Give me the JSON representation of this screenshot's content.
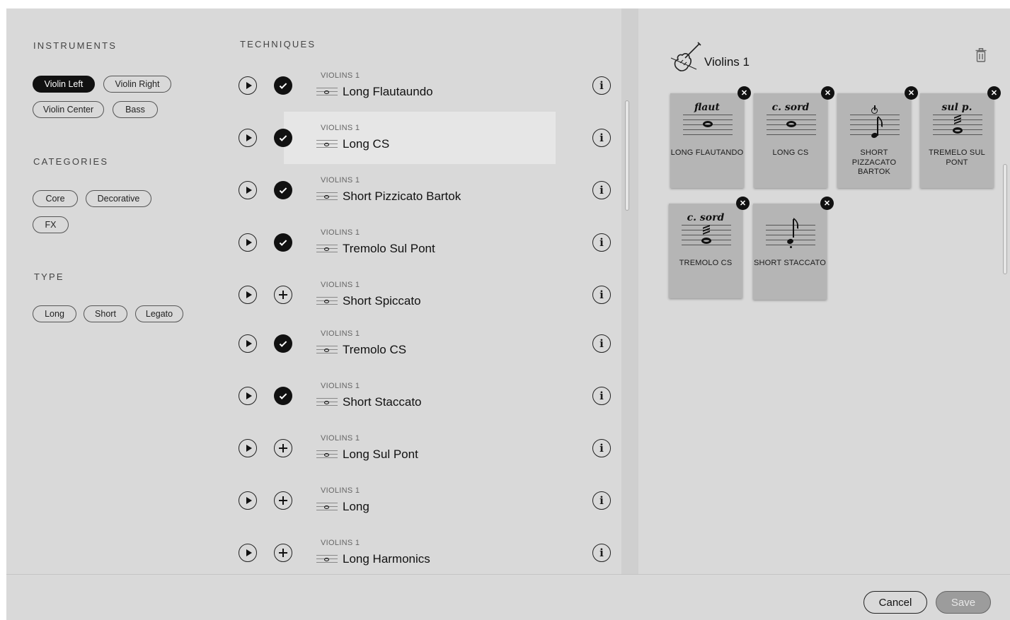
{
  "filters": {
    "instruments": {
      "title": "INSTRUMENTS",
      "items": [
        {
          "label": "Violin Left",
          "active": true
        },
        {
          "label": "Violin Right",
          "active": false
        },
        {
          "label": "Violin Center",
          "active": false
        },
        {
          "label": "Bass",
          "active": false
        }
      ]
    },
    "categories": {
      "title": "CATEGORIES",
      "items": [
        {
          "label": "Core"
        },
        {
          "label": "Decorative"
        },
        {
          "label": "FX"
        }
      ]
    },
    "type": {
      "title": "TYPE",
      "items": [
        {
          "label": "Long"
        },
        {
          "label": "Short"
        },
        {
          "label": "Legato"
        }
      ]
    }
  },
  "techniques": {
    "title": "TECHNIQUES",
    "rows": [
      {
        "instrument": "VIOLINS 1",
        "name": "Long Flautaundo",
        "selected": true,
        "highlighted": false
      },
      {
        "instrument": "VIOLINS 1",
        "name": "Long CS",
        "selected": true,
        "highlighted": true
      },
      {
        "instrument": "VIOLINS 1",
        "name": "Short Pizzicato Bartok",
        "selected": true,
        "highlighted": false
      },
      {
        "instrument": "VIOLINS 1",
        "name": "Tremolo Sul Pont",
        "selected": true,
        "highlighted": false
      },
      {
        "instrument": "VIOLINS 1",
        "name": "Short Spiccato",
        "selected": false,
        "highlighted": false
      },
      {
        "instrument": "VIOLINS 1",
        "name": "Tremolo CS",
        "selected": true,
        "highlighted": false
      },
      {
        "instrument": "VIOLINS 1",
        "name": "Short Staccato",
        "selected": true,
        "highlighted": false
      },
      {
        "instrument": "VIOLINS 1",
        "name": "Long Sul Pont",
        "selected": false,
        "highlighted": false
      },
      {
        "instrument": "VIOLINS 1",
        "name": "Long",
        "selected": false,
        "highlighted": false
      },
      {
        "instrument": "VIOLINS 1",
        "name": "Long Harmonics",
        "selected": false,
        "highlighted": false
      }
    ]
  },
  "selection": {
    "title": "Violins 1",
    "icon": "violin-icon",
    "trash_icon": "trash-icon",
    "cards": [
      {
        "marking": "flaut",
        "label": "LONG FLAUTANDO"
      },
      {
        "marking": "c. sord",
        "label": "LONG CS"
      },
      {
        "marking": "",
        "label": "SHORT PIZZACATO BARTOK"
      },
      {
        "marking": "sul p.",
        "label": "TREMELO SUL PONT"
      },
      {
        "marking": "c. sord",
        "label": "TREMOLO CS"
      },
      {
        "marking": "",
        "label": "SHORT STACCATO"
      }
    ]
  },
  "footer": {
    "cancel_label": "Cancel",
    "save_label": "Save"
  }
}
